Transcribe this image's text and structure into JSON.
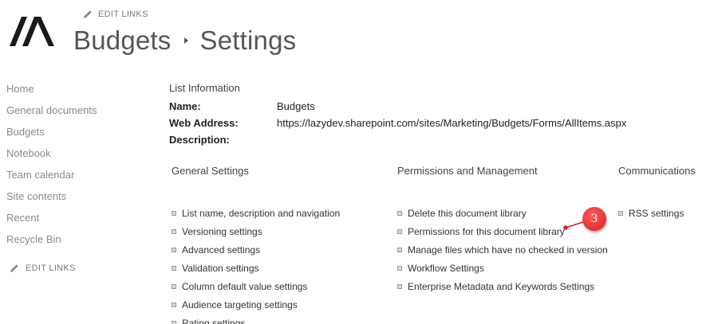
{
  "header": {
    "edit_links": "EDIT LINKS",
    "site_title": "Budgets",
    "page_title": "Settings"
  },
  "leftnav": {
    "items": [
      {
        "label": "Home"
      },
      {
        "label": "General documents"
      },
      {
        "label": "Budgets"
      },
      {
        "label": "Notebook"
      },
      {
        "label": "Team calendar"
      },
      {
        "label": "Site contents"
      },
      {
        "label": "Recent"
      },
      {
        "label": "Recycle Bin"
      }
    ],
    "edit_links": "EDIT LINKS"
  },
  "list_info": {
    "section_title": "List Information",
    "name_label": "Name:",
    "name_value": "Budgets",
    "web_address_label": "Web Address:",
    "web_address_value": "https://lazydev.sharepoint.com/sites/Marketing/Budgets/Forms/AllItems.aspx",
    "description_label": "Description:"
  },
  "general_settings": {
    "title": "General Settings",
    "links": [
      "List name, description and navigation",
      "Versioning settings",
      "Advanced settings",
      "Validation settings",
      "Column default value settings",
      "Audience targeting settings",
      "Rating settings"
    ]
  },
  "permissions": {
    "title": "Permissions and Management",
    "links": [
      "Delete this document library",
      "Permissions for this document library",
      "Manage files which have no checked in version",
      "Workflow Settings",
      "Enterprise Metadata and Keywords Settings"
    ]
  },
  "communications": {
    "title": "Communications",
    "links": [
      "RSS settings"
    ]
  },
  "annotation": {
    "number": "3",
    "color": "#d61f1f"
  },
  "icons": {
    "logo": "site-logo-icon",
    "pencil": "pencil-icon",
    "bullet": "square-bullet-icon"
  }
}
